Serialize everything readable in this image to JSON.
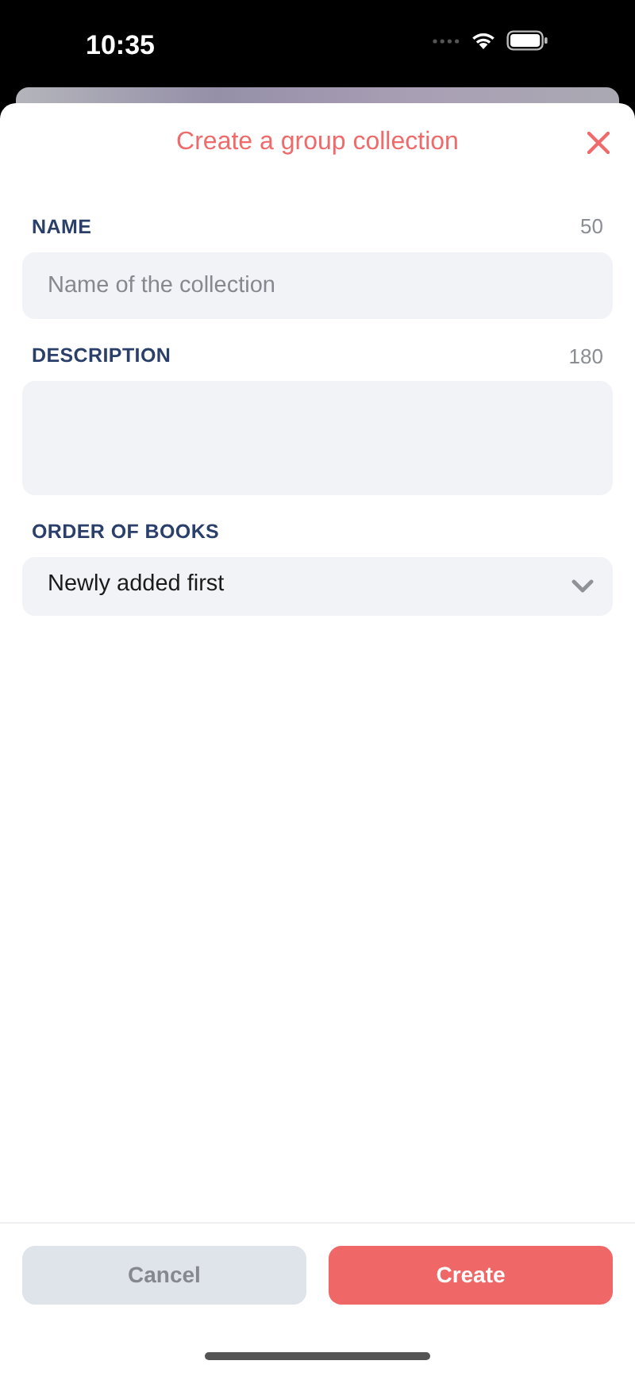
{
  "status_bar": {
    "time": "10:35"
  },
  "sheet": {
    "title": "Create a group collection"
  },
  "fields": [
    {
      "kind": "input",
      "label": "NAME",
      "counter": "50",
      "placeholder": "Name of the collection"
    },
    {
      "kind": "textarea",
      "label": "DESCRIPTION",
      "counter": "180"
    },
    {
      "kind": "select",
      "label": "ORDER OF BOOKS",
      "value": "Newly added first"
    }
  ],
  "buttons": [
    {
      "label": "Cancel",
      "kind": "secondary"
    },
    {
      "label": "Create",
      "kind": "primary"
    }
  ]
}
